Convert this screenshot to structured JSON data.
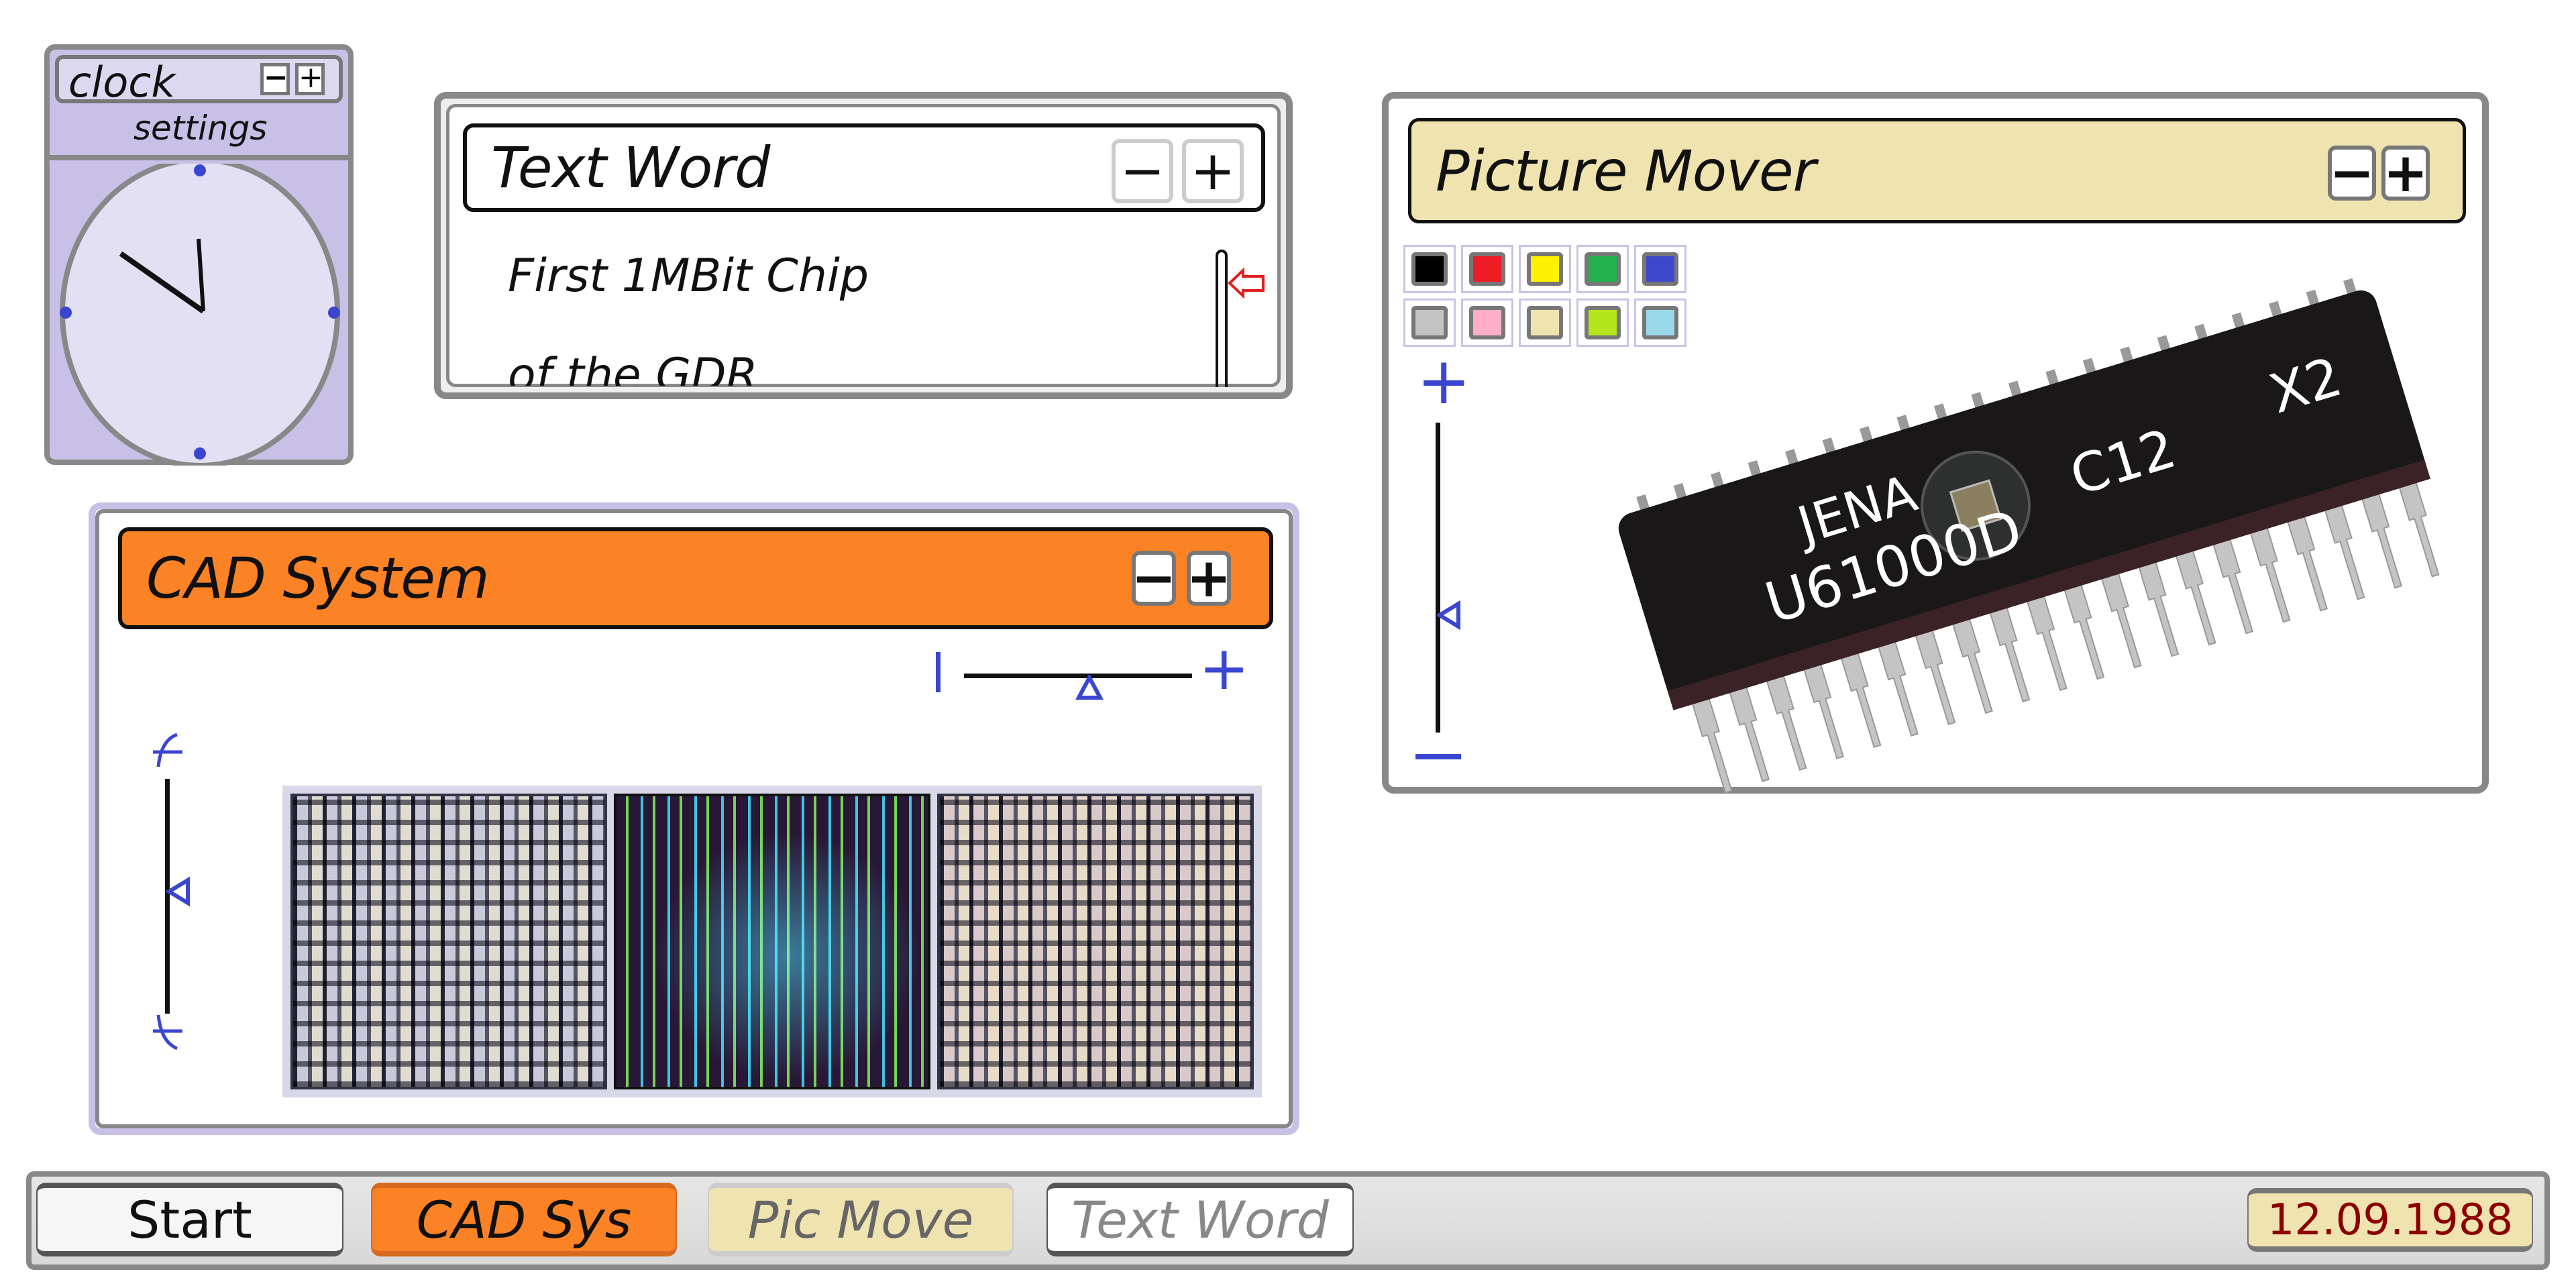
{
  "clock": {
    "title": "clock",
    "subtitle": "settings",
    "minimize": "−",
    "maximize": "+",
    "time_shown": "10:00"
  },
  "text_word": {
    "title": "Text Word",
    "minimize": "−",
    "maximize": "+",
    "lines": [
      "First 1MBit Chip",
      "of the GDR"
    ]
  },
  "cad": {
    "title": "CAD System",
    "minimize": "−",
    "maximize": "+",
    "h_slider_value_pct": 60,
    "v_slider_value_pct": 50
  },
  "picture_mover": {
    "title": "Picture Mover",
    "minimize": "−",
    "maximize": "+",
    "palette": [
      "#000000",
      "#ee1c24",
      "#fff200",
      "#22b14c",
      "#3f48cc",
      "#c3c3c3",
      "#ffaec9",
      "#efe4b0",
      "#b5e61d",
      "#99d9ea"
    ],
    "zoom_slider_value_pct": 40,
    "chip_labels": [
      "JENA",
      "U61000D",
      "C12",
      "X2"
    ]
  },
  "taskbar": {
    "start": "Start",
    "items": [
      "CAD Sys",
      "Pic Move",
      "Text Word"
    ],
    "date": "12.09.1988"
  },
  "colors": {
    "cad_accent": "#fb8225",
    "pic_accent": "#efe4b0",
    "clock_accent": "#c8c0e6",
    "slider_blue": "#3a46d0",
    "date_text": "#8b0000"
  }
}
